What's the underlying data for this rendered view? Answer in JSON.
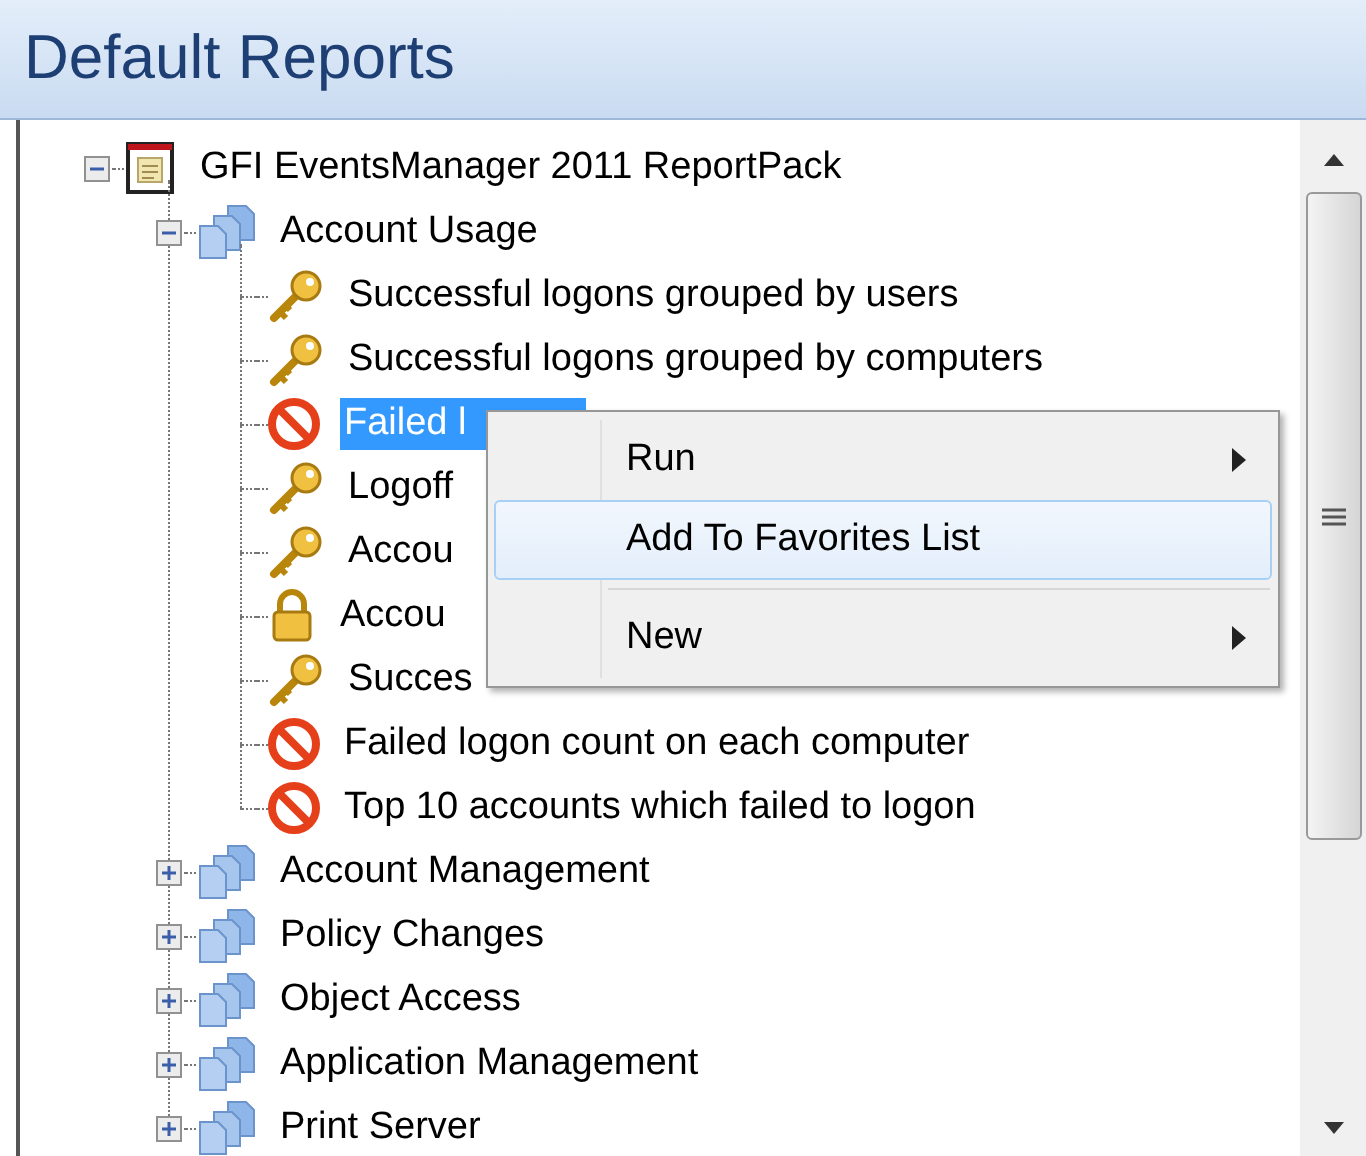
{
  "header": {
    "title": "Default Reports"
  },
  "tree": [
    {
      "label": "GFI EventsManager 2011 ReportPack",
      "kind": "report",
      "expanded": true,
      "selected": false,
      "children": [
        {
          "label": "Account Usage",
          "kind": "folder",
          "expanded": true,
          "selected": false,
          "children": [
            {
              "label": "Successful logons grouped by users",
              "kind": "key",
              "selected": false
            },
            {
              "label": "Successful logons grouped by computers",
              "kind": "key",
              "selected": false
            },
            {
              "label": "Failed l",
              "kind": "blocked",
              "selected": true
            },
            {
              "label": "Logoff",
              "kind": "key",
              "selected": false
            },
            {
              "label": "Accou",
              "kind": "key",
              "selected": false
            },
            {
              "label": "Accou",
              "kind": "lock",
              "selected": false
            },
            {
              "label": "Succes",
              "kind": "key",
              "selected": false
            },
            {
              "label": "Failed logon count on each computer",
              "kind": "blocked",
              "selected": false
            },
            {
              "label": "Top 10 accounts which failed to logon",
              "kind": "blocked",
              "selected": false
            }
          ]
        },
        {
          "label": "Account Management",
          "kind": "folder",
          "expanded": false,
          "selected": false
        },
        {
          "label": "Policy Changes",
          "kind": "folder",
          "expanded": false,
          "selected": false
        },
        {
          "label": "Object Access",
          "kind": "folder",
          "expanded": false,
          "selected": false
        },
        {
          "label": "Application Management",
          "kind": "folder",
          "expanded": false,
          "selected": false
        },
        {
          "label": "Print Server",
          "kind": "folder",
          "expanded": false,
          "selected": false
        }
      ]
    }
  ],
  "context_menu": {
    "items": [
      {
        "kind": "submenu",
        "label": "Run",
        "highlighted": false
      },
      {
        "kind": "command",
        "label": "Add To Favorites List",
        "highlighted": true
      },
      {
        "kind": "separator"
      },
      {
        "kind": "submenu",
        "label": "New",
        "highlighted": false
      }
    ]
  }
}
